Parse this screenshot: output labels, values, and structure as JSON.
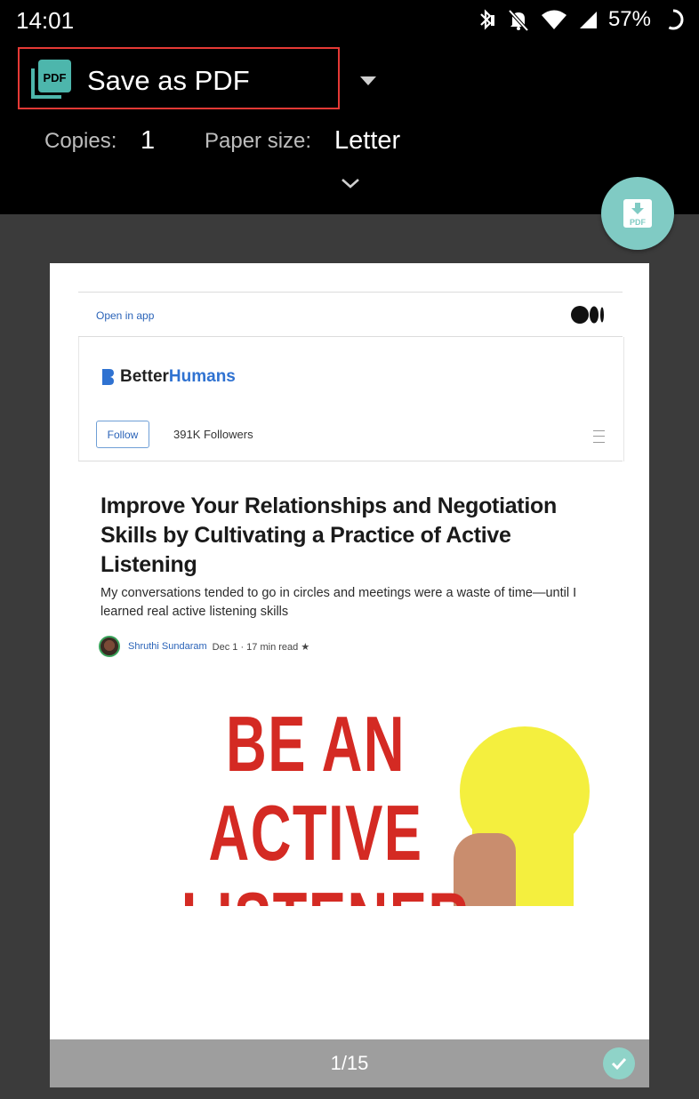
{
  "status_bar": {
    "time": "14:01",
    "battery_percent": "57%",
    "icons": [
      "bluetooth-icon",
      "bell-off-icon",
      "wifi-icon",
      "signal-icon",
      "battery-icon"
    ]
  },
  "print_settings": {
    "printer_name": "Save as PDF",
    "copies_label": "Copies:",
    "copies_value": "1",
    "paper_size_label": "Paper size:",
    "paper_size_value": "Letter",
    "pdf_fab_text": "PDF"
  },
  "preview": {
    "open_in_app": "Open in app",
    "publication": {
      "name_part1": "Better",
      "name_part2": "Humans"
    },
    "follow_label": "Follow",
    "followers": "391K Followers",
    "headline": "Improve Your Relationships and Negotiation Skills by Cultivating a Practice of Active Listening",
    "subtitle": "My conversations tended to go in circles and meetings were a waste of time—until I learned real active listening skills",
    "author": "Shruthi Sundaram",
    "date_meta": "Dec 1 · 17 min read ★",
    "hero_lines": [
      "BE AN",
      "ACTIVE",
      "LISTENER"
    ]
  },
  "page_indicator": "1/15",
  "colors": {
    "accent_red_outline": "#e53935",
    "fab_teal": "#80cbc4",
    "link_blue": "#2a63b8",
    "hero_red": "#d42a23"
  }
}
